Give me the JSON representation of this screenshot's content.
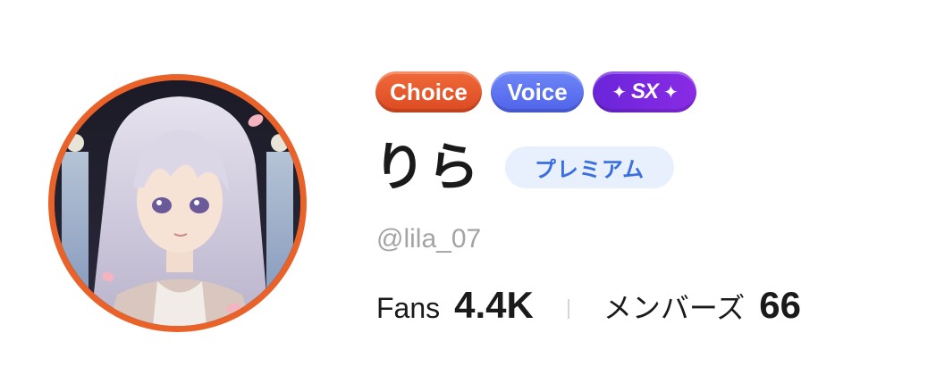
{
  "profile": {
    "badges": {
      "choice": "Choice",
      "voice": "Voice",
      "sx": "SX"
    },
    "name": "りら",
    "membership": "プレミアム",
    "handle": "@lila_07",
    "stats": {
      "fans_label": "Fans",
      "fans_value": "4.4K",
      "members_label": "メンバーズ",
      "members_value": "66"
    }
  },
  "colors": {
    "avatar_ring": "#e8622a",
    "choice_badge": "#e35429",
    "voice_badge": "#5a6ff0",
    "sx_badge": "#7a28df",
    "premium_bg": "#e8effd",
    "premium_text": "#3a6fe0",
    "handle_text": "#a4a4a4"
  },
  "icons": {
    "sparkle": "sparkle-icon"
  }
}
